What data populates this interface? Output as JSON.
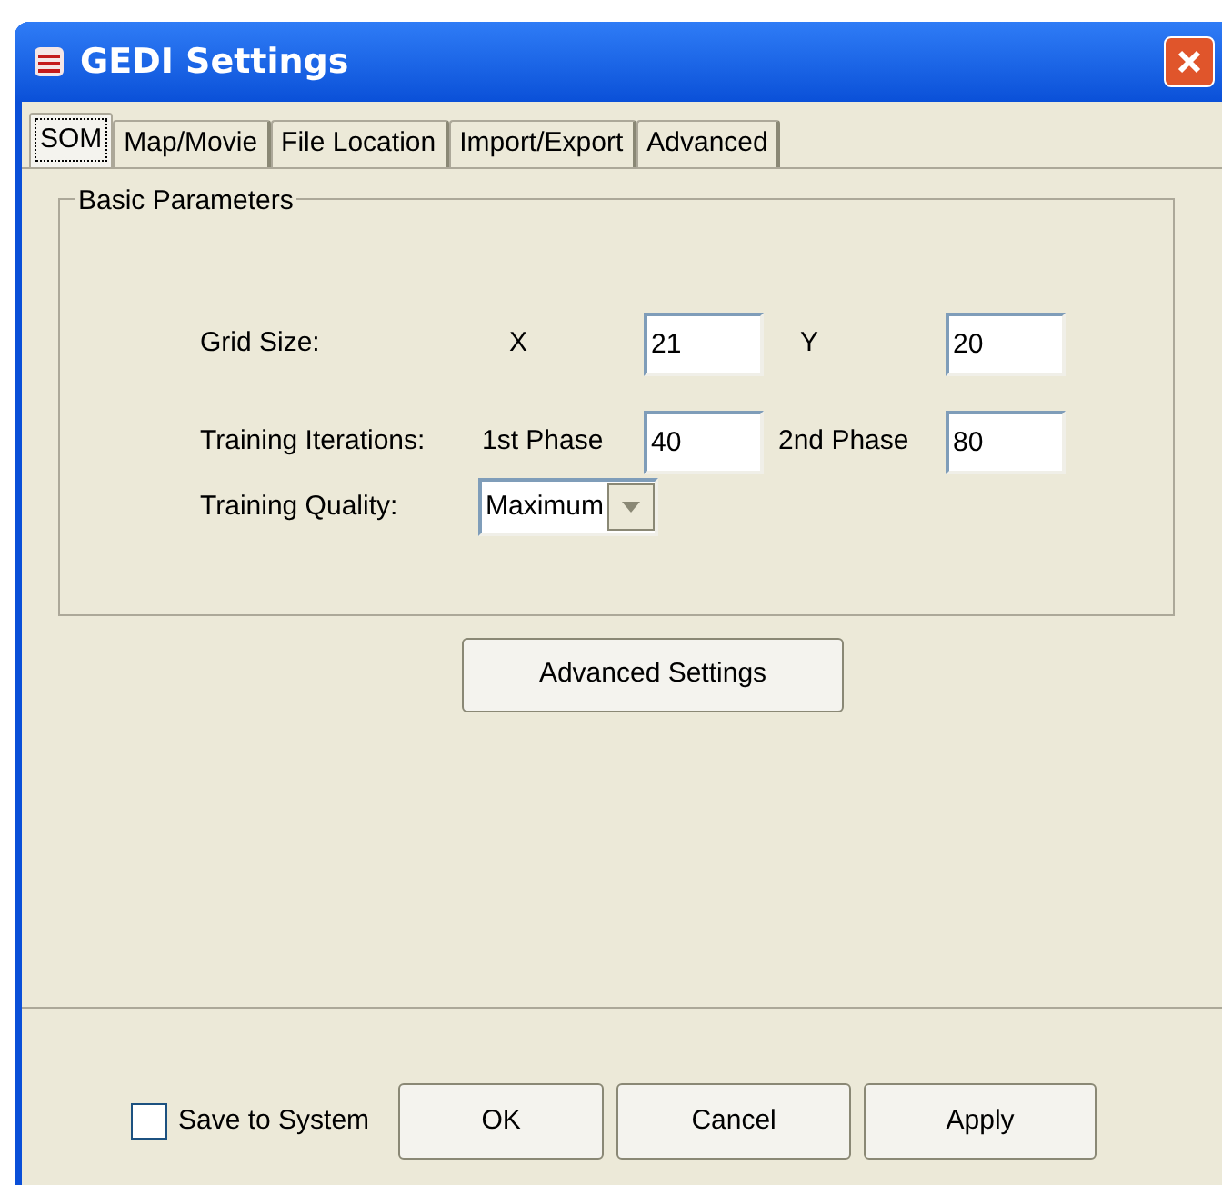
{
  "window": {
    "title": "GEDI Settings"
  },
  "tabs": [
    {
      "label": "SOM",
      "selected": true
    },
    {
      "label": "Map/Movie",
      "selected": false
    },
    {
      "label": "File Location",
      "selected": false
    },
    {
      "label": "Import/Export",
      "selected": false
    },
    {
      "label": "Advanced",
      "selected": false
    }
  ],
  "group": {
    "title": "Basic Parameters",
    "grid_size": {
      "label": "Grid Size:",
      "x_label": "X",
      "x_value": "21",
      "y_label": "Y",
      "y_value": "20"
    },
    "training_iterations": {
      "label": "Training Iterations:",
      "phase1_label": "1st Phase",
      "phase1_value": "40",
      "phase2_label": "2nd Phase",
      "phase2_value": "80"
    },
    "training_quality": {
      "label": "Training Quality:",
      "value": "Maximum"
    }
  },
  "advanced_button": "Advanced Settings",
  "footer": {
    "save_to_system": {
      "label": "Save to System",
      "checked": false
    },
    "buttons": [
      "OK",
      "Cancel",
      "Apply"
    ]
  }
}
